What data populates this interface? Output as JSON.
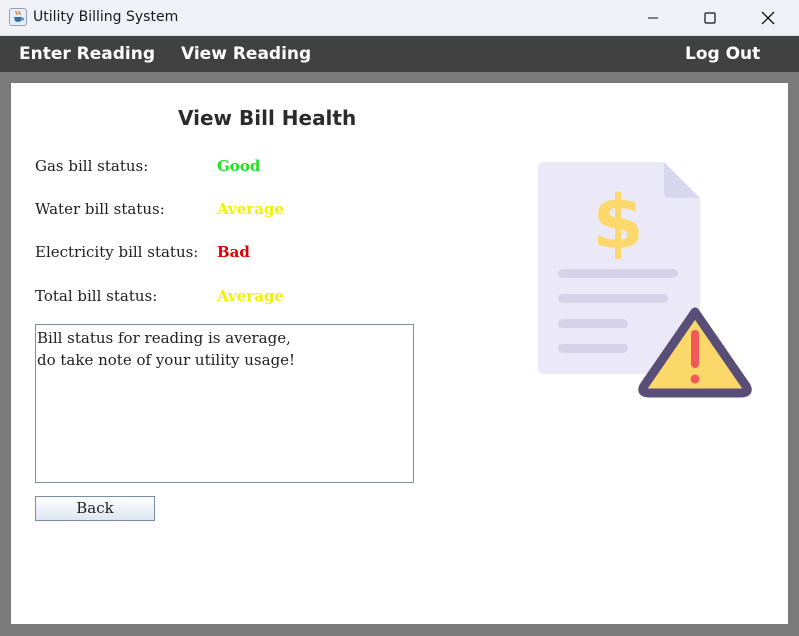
{
  "window": {
    "title": "Utility Billing System",
    "icons": {
      "app": "java-cup-icon",
      "minimize": "minimize-icon",
      "maximize": "maximize-icon",
      "close": "close-icon"
    }
  },
  "menu": {
    "enter_reading": "Enter Reading",
    "view_reading": "View Reading",
    "log_out": "Log Out"
  },
  "page": {
    "title": "View Bill Health",
    "statuses": [
      {
        "label": "Gas bill status:",
        "value": "Good",
        "color": "#22e022"
      },
      {
        "label": "Water bill status:",
        "value": "Average",
        "color": "#f2f200"
      },
      {
        "label": "Electricity bill status:",
        "value": "Bad",
        "color": "#e00000"
      },
      {
        "label": "Total bill status:",
        "value": "Average",
        "color": "#f2f200"
      }
    ],
    "message": "Bill status for reading is average,\ndo take note of your utility usage!",
    "back_label": "Back",
    "illustration_icon": "bill-warning-icon"
  },
  "colors": {
    "menubar": "#414141",
    "document": "#ebe9f7",
    "dollar": "#fcd86a",
    "warning_fill": "#fcd86a",
    "warning_border": "#594e78",
    "exclamation": "#f25a5a"
  }
}
